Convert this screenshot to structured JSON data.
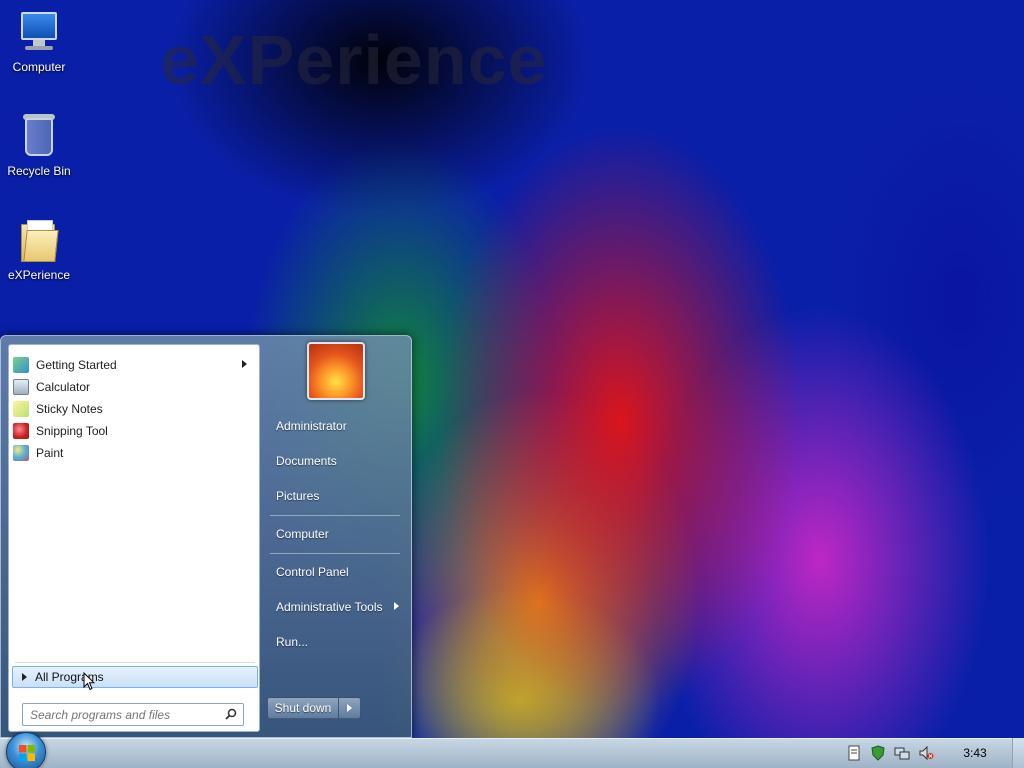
{
  "wallpaper": {
    "title": "eXPerience"
  },
  "desktop": {
    "icons": [
      {
        "label": "Computer",
        "icon": "computer-icon"
      },
      {
        "label": "Recycle Bin",
        "icon": "recycle-bin-icon"
      },
      {
        "label": "eXPerience",
        "icon": "folder-icon"
      }
    ]
  },
  "start_menu": {
    "programs": [
      {
        "label": "Getting Started",
        "icon": "getting-started-icon",
        "has_submenu": true
      },
      {
        "label": "Calculator",
        "icon": "calculator-icon"
      },
      {
        "label": "Sticky Notes",
        "icon": "sticky-notes-icon"
      },
      {
        "label": "Snipping Tool",
        "icon": "snipping-tool-icon"
      },
      {
        "label": "Paint",
        "icon": "paint-icon"
      }
    ],
    "all_programs": "All Programs",
    "search_placeholder": "Search programs and files",
    "right": {
      "user": "Administrator",
      "documents": "Documents",
      "pictures": "Pictures",
      "computer": "Computer",
      "control_panel": "Control Panel",
      "admin_tools": "Administrative Tools",
      "run": "Run..."
    },
    "shutdown_label": "Shut down"
  },
  "taskbar": {
    "clock": "3:43",
    "tray_icons": [
      "action-center-icon",
      "security-icon",
      "network-icon",
      "volume-muted-icon"
    ]
  },
  "colors": {
    "accent": "#3b8fd6",
    "menu_bg": "#5a7a9a"
  }
}
